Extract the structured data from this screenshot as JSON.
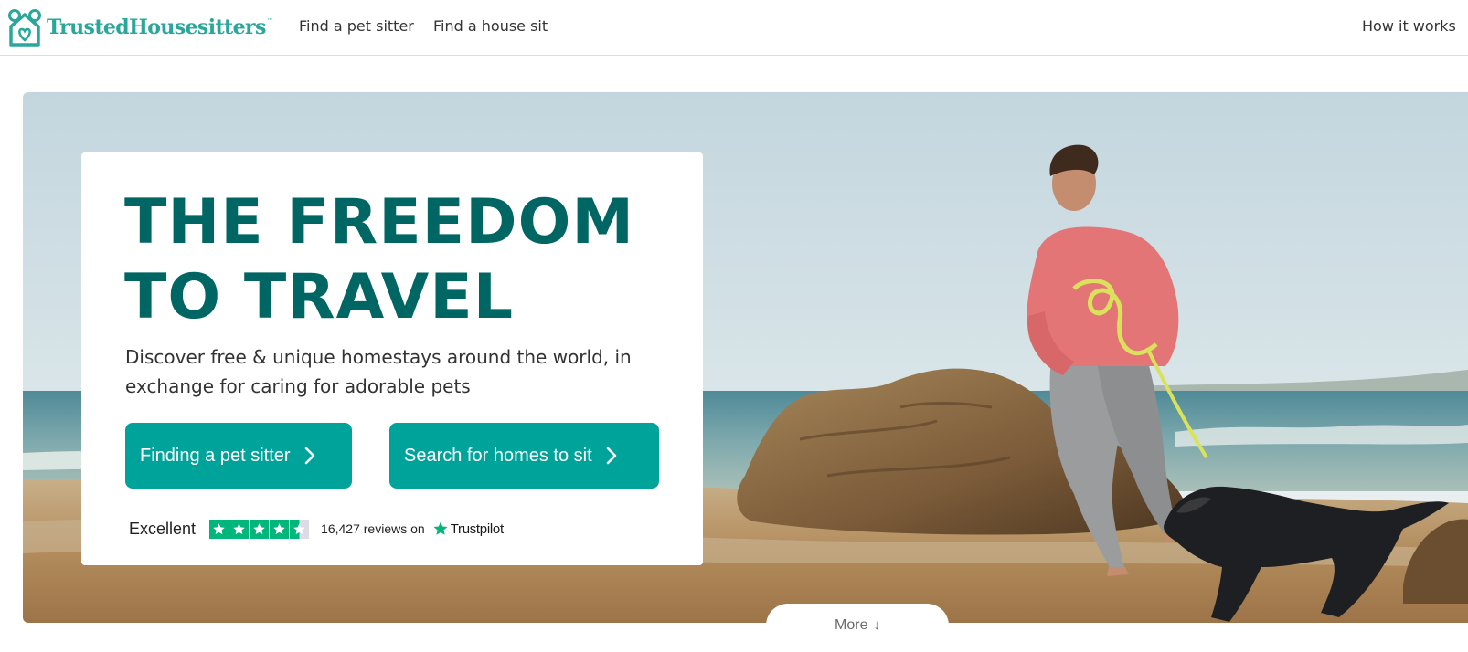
{
  "header": {
    "brand": "TrustedHousesitters",
    "brand_tm": "™",
    "nav": {
      "find_pet_sitter": "Find a pet sitter",
      "find_house_sit": "Find a house sit",
      "how_it_works": "How it works"
    }
  },
  "hero": {
    "headline_line1": "THE FREEDOM",
    "headline_line2": "TO TRAVEL",
    "subcopy": "Discover free & unique homestays around the world, in exchange for caring for adorable pets",
    "buttons": {
      "sitter_label": "Finding a pet sitter",
      "homes_label": "Search for homes to sit"
    },
    "rating": {
      "word": "Excellent",
      "stars": 4.5,
      "stars_max": 5,
      "review_text": "16,427 reviews on",
      "provider": "Trustpilot"
    },
    "more": {
      "label": "More",
      "arrow": "↓"
    }
  },
  "colors": {
    "brand_teal": "#2aa79a",
    "headline": "#006664",
    "button": "#00a39a",
    "trustpilot_green": "#00b67a"
  },
  "icons": {
    "logo": "house-with-paws-icon",
    "button_chevron": "chevron-right-icon",
    "star": "star-icon",
    "trustpilot": "trustpilot-star-icon"
  }
}
